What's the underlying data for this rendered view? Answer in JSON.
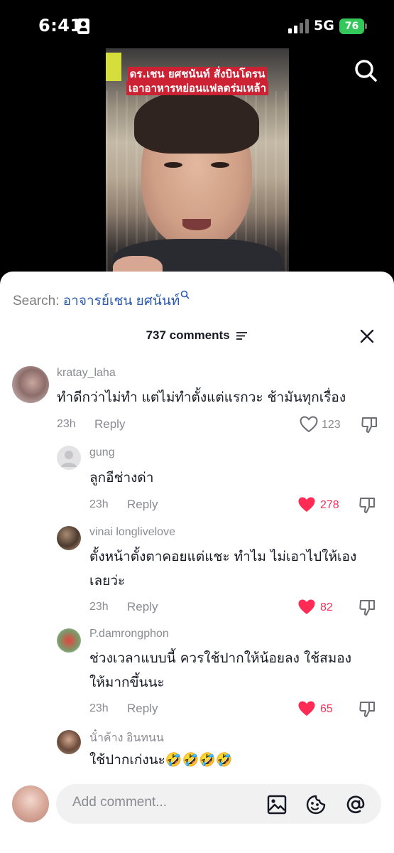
{
  "status_bar": {
    "time": "6:41",
    "network": "5G",
    "battery": "76"
  },
  "video": {
    "caption_line1": "ดร.เชน ยศชนันท์ สั่งบินโดรน",
    "caption_line2": "เอาอาหารหย่อนแฟลตร่มเหล้า"
  },
  "sheet": {
    "search_prefix": "Search:",
    "search_term": "อาจารย์เชน ยศนันท์",
    "comment_count": "737 comments"
  },
  "comments": [
    {
      "username": "kratay_laha",
      "text": "ทำดีกว่าไม่ทำ แต่ไม่ทำตั้งแต่แรกวะ ช้ามันทุกเรื่อง",
      "time": "23h",
      "reply": "Reply",
      "likes": "123",
      "liked": false
    },
    {
      "username": "gung",
      "text": "ลูกอีช่างด่า",
      "time": "23h",
      "reply": "Reply",
      "likes": "278",
      "liked": true
    },
    {
      "username": "vinai longlivelove",
      "text_line1": "ตั้งหน้าตั้งตาคอยแต่แชะ ทำไม ไม่เอาไปให้เอง",
      "text_line2": "เลยว่ะ",
      "time": "23h",
      "reply": "Reply",
      "likes": "82",
      "liked": true
    },
    {
      "username": "P.damrongphon",
      "text_line1": "ช่วงเวลาแบบนี้ ควรใช้ปากให้น้อยลง ใช้สมอง",
      "text_line2": "ให้มากขึ้นนะ",
      "time": "23h",
      "reply": "Reply",
      "likes": "65",
      "liked": true
    },
    {
      "username": "นั๋าค้าง อินทนน",
      "text": "ใช้ปากเก่งนะ🤣🤣🤣🤣"
    }
  ],
  "input": {
    "placeholder": "Add comment..."
  },
  "colors": {
    "liked": "#fe2c55",
    "link": "#2b5bb5",
    "muted": "#8a8b91"
  },
  "icons": [
    "search-icon",
    "sort-icon",
    "close-icon",
    "heart-icon",
    "dislike-icon",
    "image-icon",
    "emoji-icon",
    "mention-icon"
  ]
}
